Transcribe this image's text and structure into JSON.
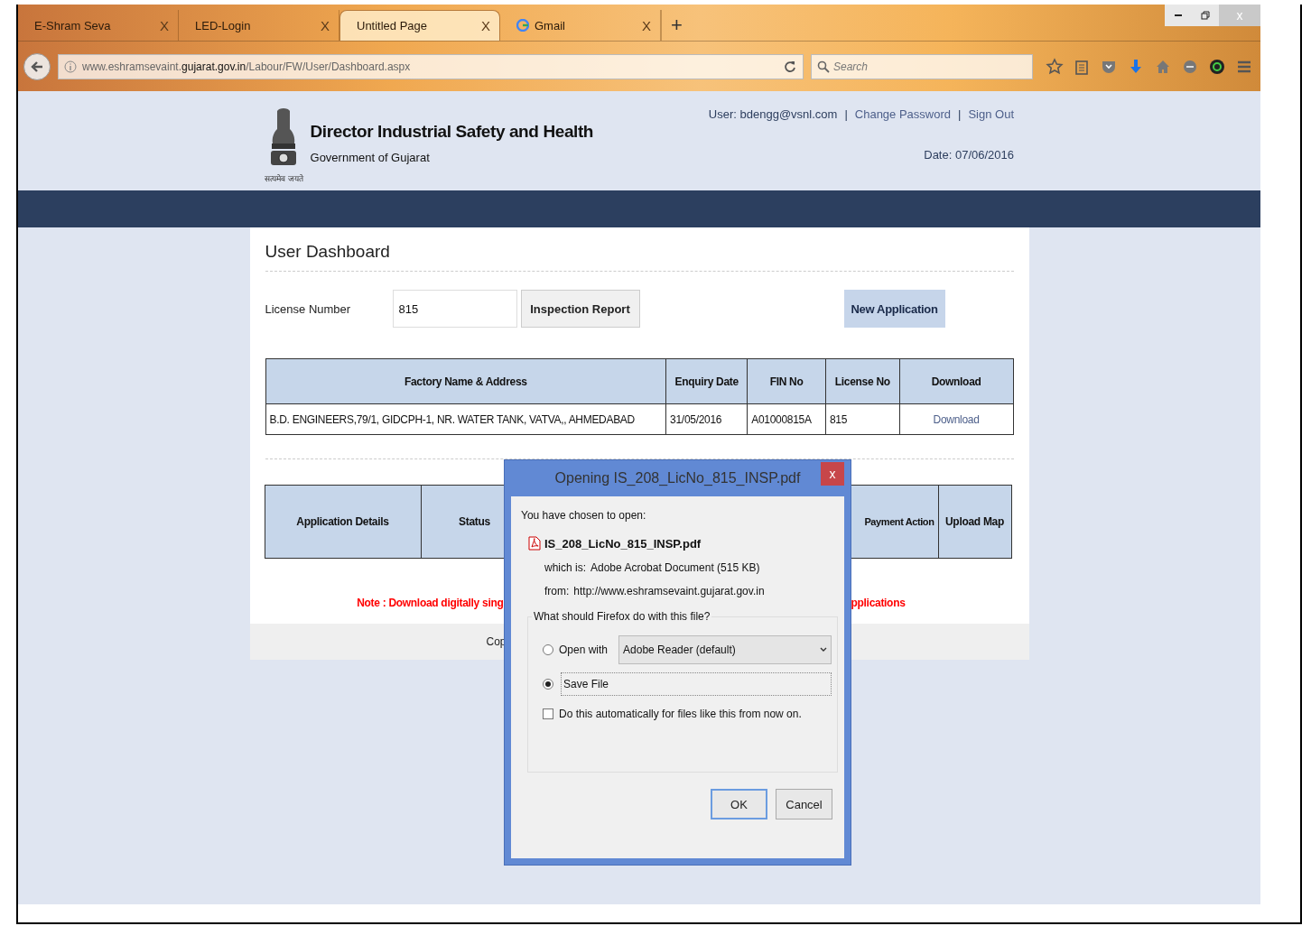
{
  "browser": {
    "tabs": [
      {
        "label": "E-Shram Seva",
        "selected": false,
        "favicon": false,
        "close": "X"
      },
      {
        "label": "LED-Login",
        "selected": false,
        "favicon": false,
        "close": "X"
      },
      {
        "label": "Untitled Page",
        "selected": true,
        "favicon": false,
        "close": "X"
      },
      {
        "label": "Gmail",
        "selected": false,
        "favicon": true,
        "close": "X"
      }
    ],
    "new_tab": "+",
    "window_close": "x",
    "address": {
      "prefix": "www.eshramsevaint.",
      "domain": "gujarat.gov.in",
      "path": "/Labour/FW/User/Dashboard.aspx"
    },
    "search": {
      "placeholder": "Search"
    }
  },
  "header": {
    "title": "Director Industrial Safety and Health",
    "subtitle": "Government of Gujarat",
    "emblem_caption": "सत्यमेव जयते",
    "user": "User: bdengg@vsnl.com",
    "links": [
      {
        "separator": "|",
        "label": "Change Password"
      },
      {
        "separator": "|",
        "label": "Sign Out"
      }
    ],
    "date": "Date: 07/06/2016"
  },
  "dashboard": {
    "title": "User Dashboard",
    "license_label": "License Number",
    "license_value": "815",
    "inspection_button": "Inspection Report",
    "new_application_button": "New Application",
    "table": {
      "columns": [
        "Factory Name & Address",
        "Enquiry Date",
        "FIN No",
        "License No",
        "Download"
      ],
      "rows": [
        [
          "B.D. ENGINEERS,79/1, GIDCPH-1, NR. WATER TANK, VATVA,, AHMEDABAD",
          "31/05/2016",
          "A01000815A",
          "815",
          "Download"
        ]
      ]
    },
    "applications_table": {
      "columns_left": [
        "Application Details",
        "Status"
      ],
      "columns_right": [
        "Payment Action",
        "Upload Map"
      ]
    },
    "note_left": "Note : Download digitally sing",
    "note_right": "pplications",
    "footer": "Cop"
  },
  "dialog": {
    "title": "Opening IS_208_LicNo_815_INSP.pdf",
    "close": "x",
    "intro": "You have chosen to open:",
    "filename": "IS_208_LicNo_815_INSP.pdf",
    "which_label": "which is:",
    "which_value": "Adobe Acrobat Document (515 KB)",
    "from_label": "from:",
    "from_value": "http://www.eshramsevaint.gujarat.gov.in",
    "question": "What should Firefox do with this file?",
    "options": [
      {
        "label": "Open with",
        "selected": false,
        "kind": "app"
      },
      {
        "label": "Save File",
        "selected": true,
        "kind": "plain"
      }
    ],
    "app_choice": "Adobe Reader  (default)",
    "auto": {
      "label": "Do this automatically for files like this from now on.",
      "checked": false
    },
    "buttons": [
      "OK",
      "Cancel"
    ]
  }
}
